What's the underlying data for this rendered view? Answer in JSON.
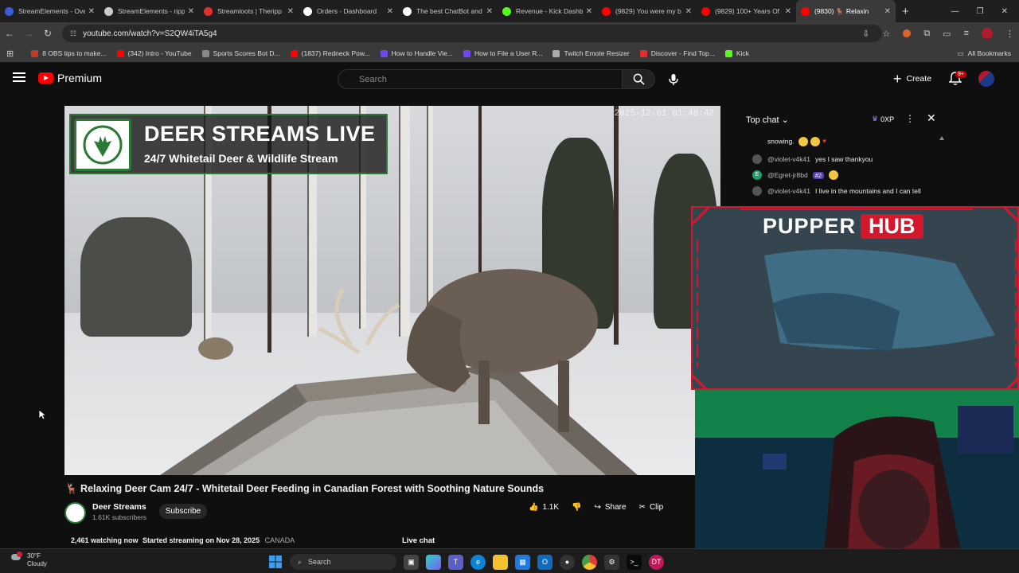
{
  "browser": {
    "tabs": [
      {
        "label": "StreamElements - Ove",
        "color": "#3b5bdb"
      },
      {
        "label": "StreamElements - ripp",
        "color": "#cccccc"
      },
      {
        "label": "Streamloots | Theripp",
        "color": "#e03131"
      },
      {
        "label": "Orders - Dashboard",
        "color": "#ffffff"
      },
      {
        "label": "The best ChatBot and",
        "color": "#ffffff"
      },
      {
        "label": "Revenue - Kick Dashb",
        "color": "#53fc18"
      },
      {
        "label": "(9829) You were my b",
        "color": "#ff0000"
      },
      {
        "label": "(9829) 100+ Years Of",
        "color": "#ff0000"
      },
      {
        "label": "(9830) 🦌 Relaxin",
        "color": "#ff0000"
      }
    ],
    "url": "youtube.com/watch?v=S2QW4iTA5g4",
    "bookmarks": [
      {
        "label": "8 OBS tips to make...",
        "color": "#c0392b"
      },
      {
        "label": "(342) Intro - YouTube",
        "color": "#ff0000"
      },
      {
        "label": "Sports Scores Bot D...",
        "color": "#888888"
      },
      {
        "label": "(1837) Redneck Pow...",
        "color": "#ff0000"
      },
      {
        "label": "How to Handle Vie...",
        "color": "#7048e8"
      },
      {
        "label": "How to File a User R...",
        "color": "#7048e8"
      },
      {
        "label": "Twitch Emote Resizer",
        "color": "#aaaaaa"
      },
      {
        "label": "Discover - Find Top...",
        "color": "#e03131"
      },
      {
        "label": "Kick",
        "color": "#53fc18"
      }
    ],
    "all_bookmarks": "All Bookmarks"
  },
  "youtube": {
    "logo_text": "Premium",
    "search_placeholder": "Search",
    "create_label": "Create",
    "notification_badge": "9+"
  },
  "video": {
    "overlay_title": "DEER STREAMS LIVE",
    "overlay_subtitle": "24/7 Whitetail Deer & Wildlife Stream",
    "timestamp": "2025-12-01 01:48:42",
    "title": "🦌 Relaxing Deer Cam 24/7 - Whitetail Deer Feeding in Canadian Forest with Soothing Nature Sounds",
    "channel_name": "Deer Streams",
    "subscribers": "1.61K subscribers",
    "subscribe_label": "Subscribe",
    "likes": "1.1K",
    "share_label": "Share",
    "clip_label": "Clip",
    "watching": "2,461 watching now",
    "started": "Started streaming on Nov 28, 2025",
    "country": "CANADA",
    "live_chat_label": "Live chat"
  },
  "chat": {
    "header": "Top chat",
    "xp": "0XP",
    "top_line": "snowing.",
    "messages": [
      {
        "user": "@violet-v4k41",
        "text": "yes I saw thankyou",
        "avatar_color": "#555555"
      },
      {
        "user": "@Egret-jr8bd",
        "text": "#2",
        "avatar_color": "#1f9c6a",
        "avatar_letter": "E"
      },
      {
        "user": "@violet-v4k41",
        "text": "I live in the mountains and I can tell",
        "avatar_color": "#555555"
      }
    ]
  },
  "stream_overlay": {
    "brand_left": "PUPPER",
    "brand_right": "HUB",
    "accent": "#d3182d"
  },
  "taskbar": {
    "temp": "30°F",
    "condition": "Cloudy",
    "search_label": "Search"
  }
}
